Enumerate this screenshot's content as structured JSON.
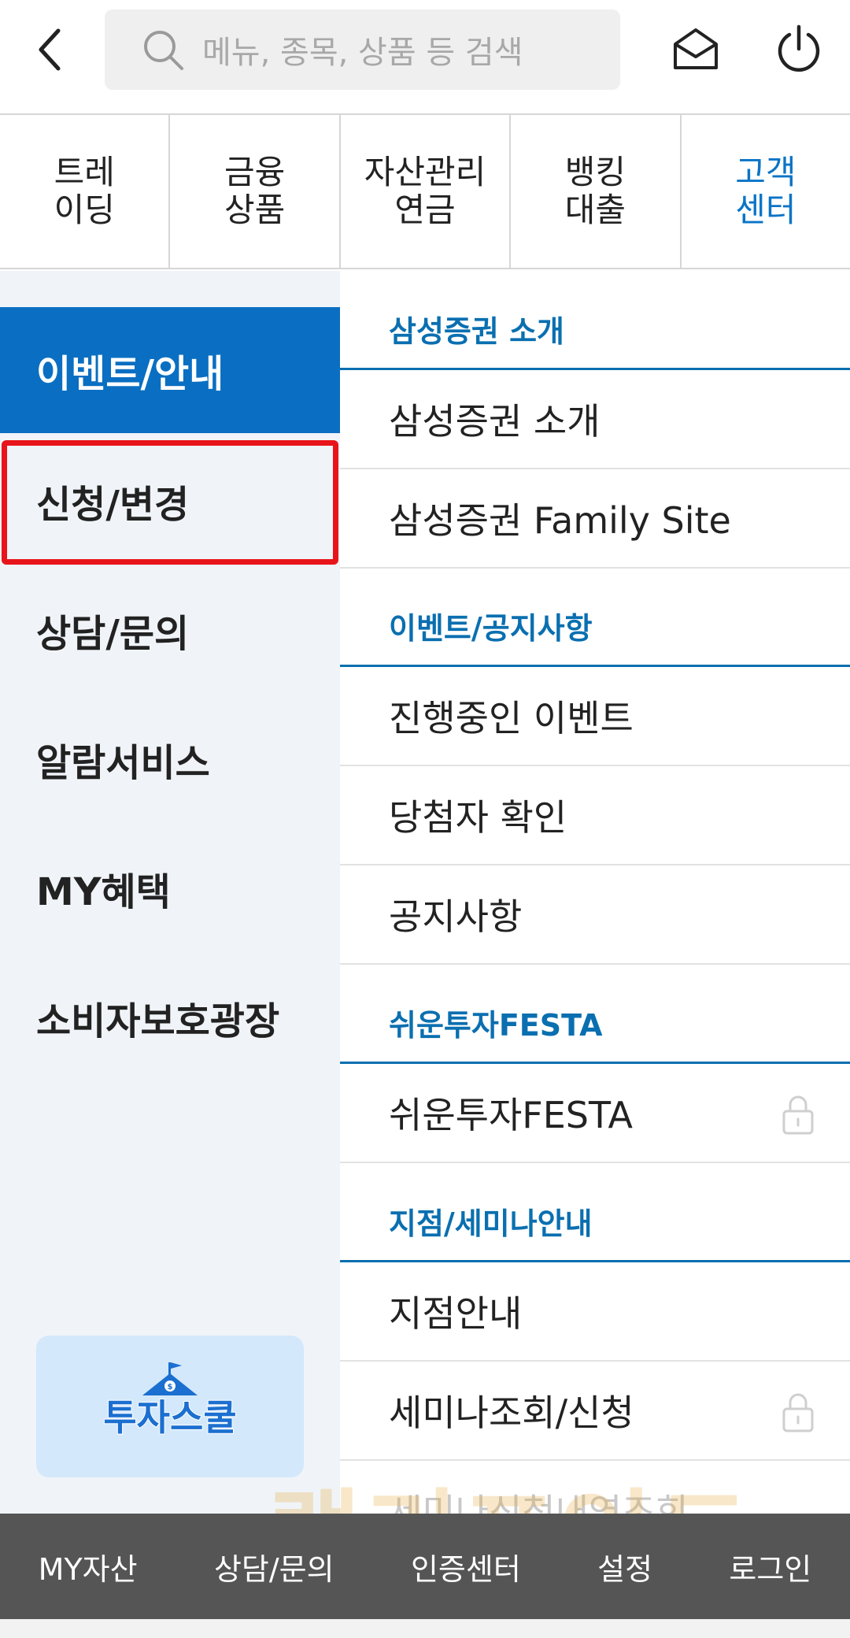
{
  "search": {
    "placeholder": "메뉴, 종목, 상품 등 검색"
  },
  "tabs": [
    {
      "line1": "트레",
      "line2": "이딩"
    },
    {
      "line1": "금융",
      "line2": "상품"
    },
    {
      "line1": "자산관리",
      "line2": "연금"
    },
    {
      "line1": "뱅킹",
      "line2": "대출"
    },
    {
      "line1": "고객",
      "line2": "센터"
    }
  ],
  "left_menu": [
    {
      "label": "이벤트/안내"
    },
    {
      "label": "신청/변경"
    },
    {
      "label": "상담/문의"
    },
    {
      "label": "알람서비스"
    },
    {
      "label": "MY혜택"
    },
    {
      "label": "소비자보호광장"
    }
  ],
  "banner": {
    "label": "투자스쿨"
  },
  "sections": [
    {
      "title": "삼성증권 소개",
      "items": [
        "삼성증권 소개",
        "삼성증권 Family Site"
      ]
    },
    {
      "title": "이벤트/공지사항",
      "items": [
        "진행중인 이벤트",
        "당첨자 확인",
        "공지사항"
      ]
    },
    {
      "title": "쉬운투자FESTA",
      "items": [
        "쉬운투자FESTA"
      ]
    },
    {
      "title": "지점/세미나안내",
      "items": [
        "지점안내",
        "세미나조회/신청",
        "세미나신청내역조회"
      ]
    }
  ],
  "bottom_bar": [
    "MY자산",
    "상담/문의",
    "인증센터",
    "설정",
    "로그인"
  ],
  "watermark": "랠리포인트",
  "colors": {
    "accent": "#0a6fc2",
    "highlight_border": "#e8141b",
    "bottom_bar": "#555555"
  },
  "icons": {
    "back": "chevron-left-icon",
    "search": "search-icon",
    "mail": "mail-icon",
    "power": "power-icon",
    "lock": "lock-icon"
  }
}
